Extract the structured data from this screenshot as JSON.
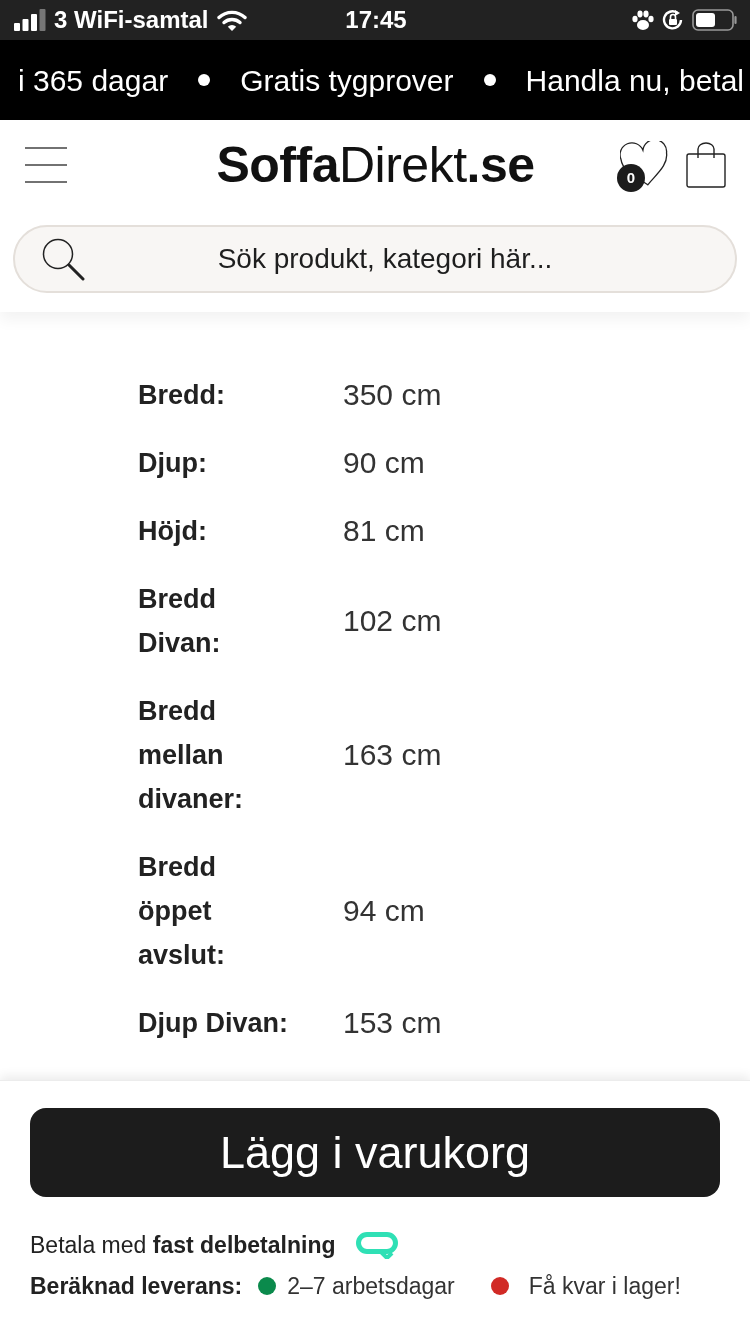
{
  "status_bar": {
    "carrier": "3 WiFi-samtal",
    "time": "17:45"
  },
  "announcement_bar": {
    "messages": [
      "i 365 dagar",
      "Gratis tygprover",
      "Handla nu, betal"
    ]
  },
  "header": {
    "logo": "**Soffa**Direkt**.se**",
    "wishlist_count": "0"
  },
  "search": {
    "placeholder": "Sök produkt, kategori här..."
  },
  "specifications": [
    {
      "label": "Bredd:",
      "value": "350 cm"
    },
    {
      "label": "Djup:",
      "value": "90 cm"
    },
    {
      "label": "Höjd:",
      "value": "81 cm"
    },
    {
      "label": "Bredd Divan:",
      "value": "102 cm"
    },
    {
      "label": "Bredd mellan divaner:",
      "value": "163 cm"
    },
    {
      "label": "Bredd öppet avslut:",
      "value": "94 cm"
    },
    {
      "label": "Djup Divan:",
      "value": "153 cm"
    }
  ],
  "add_to_cart": {
    "label": "Lägg i varukorg"
  },
  "payment_note": "Betala med **fast delbetalning**",
  "delivery": {
    "label": "Beräknad leverans:",
    "statuses": [
      {
        "text": "2–7 arbetsdagar",
        "color": "#0b8a4c"
      },
      {
        "text": "Få kvar i lager!",
        "color": "#d12a26"
      }
    ]
  }
}
